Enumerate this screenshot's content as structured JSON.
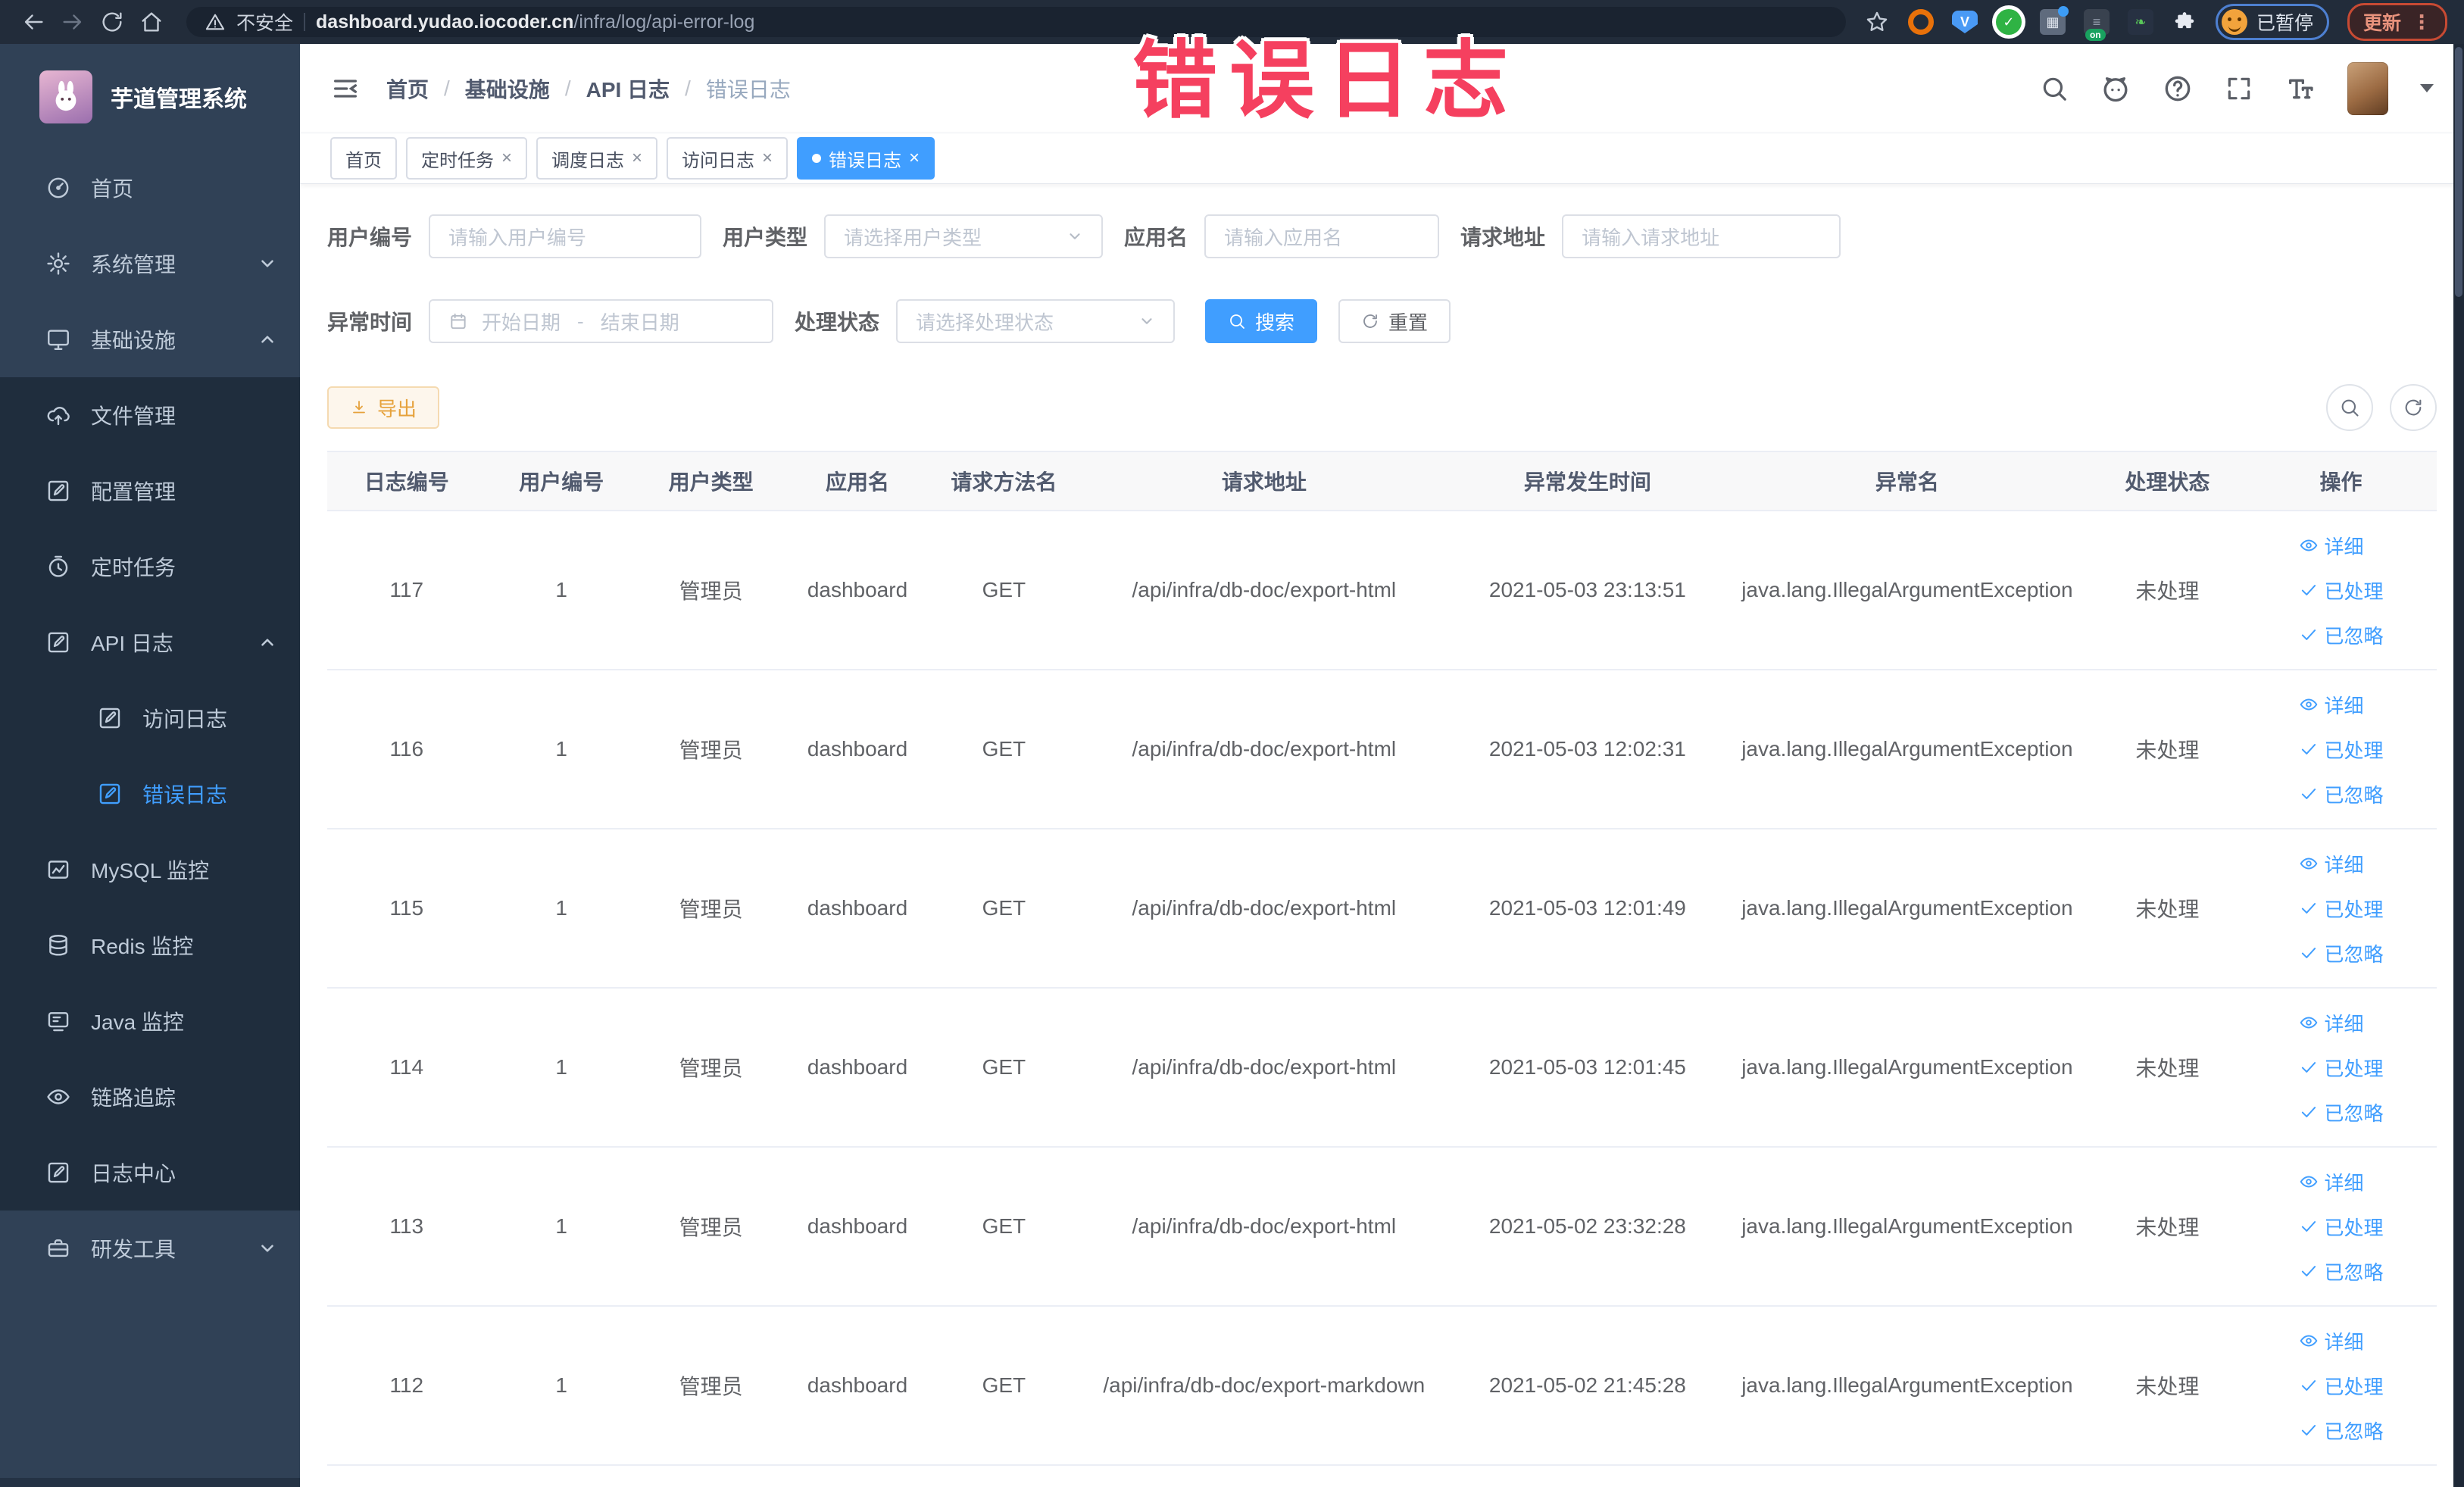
{
  "browser": {
    "security_label": "不安全",
    "url_domain": "dashboard.yudao.iocoder.cn",
    "url_path": "/infra/log/api-error-log",
    "profile_status": "已暂停",
    "update_button": "更新"
  },
  "annotation": {
    "text": "错误日志"
  },
  "sidebar": {
    "title": "芋道管理系统",
    "items": [
      {
        "label": "首页"
      },
      {
        "label": "系统管理"
      },
      {
        "label": "基础设施"
      },
      {
        "label": "文件管理"
      },
      {
        "label": "配置管理"
      },
      {
        "label": "定时任务"
      },
      {
        "label": "API 日志"
      },
      {
        "label": "访问日志"
      },
      {
        "label": "错误日志"
      },
      {
        "label": "MySQL 监控"
      },
      {
        "label": "Redis 监控"
      },
      {
        "label": "Java 监控"
      },
      {
        "label": "链路追踪"
      },
      {
        "label": "日志中心"
      },
      {
        "label": "研发工具"
      }
    ]
  },
  "breadcrumb": [
    "首页",
    "基础设施",
    "API 日志",
    "错误日志"
  ],
  "tags": [
    {
      "label": "首页"
    },
    {
      "label": "定时任务"
    },
    {
      "label": "调度日志"
    },
    {
      "label": "访问日志"
    },
    {
      "label": "错误日志"
    }
  ],
  "filters": {
    "user_id": {
      "label": "用户编号",
      "placeholder": "请输入用户编号"
    },
    "user_type": {
      "label": "用户类型",
      "placeholder": "请选择用户类型"
    },
    "app_name": {
      "label": "应用名",
      "placeholder": "请输入应用名"
    },
    "request_url": {
      "label": "请求地址",
      "placeholder": "请输入请求地址"
    },
    "exception_time": {
      "label": "异常时间",
      "start_placeholder": "开始日期",
      "separator": "-",
      "end_placeholder": "结束日期"
    },
    "process_status": {
      "label": "处理状态",
      "placeholder": "请选择处理状态"
    },
    "search_button": "搜索",
    "reset_button": "重置"
  },
  "toolbar": {
    "export_button": "导出"
  },
  "table": {
    "columns": [
      "日志编号",
      "用户编号",
      "用户类型",
      "应用名",
      "请求方法名",
      "请求地址",
      "异常发生时间",
      "异常名",
      "处理状态",
      "操作"
    ],
    "actions": {
      "detail": "详细",
      "processed": "已处理",
      "ignored": "已忽略"
    },
    "rows": [
      {
        "id": "117",
        "user_id": "1",
        "user_type": "管理员",
        "app": "dashboard",
        "method": "GET",
        "url": "/api/infra/db-doc/export-html",
        "time": "2021-05-03 23:13:51",
        "exception": "java.lang.IllegalArgumentException",
        "status": "未处理"
      },
      {
        "id": "116",
        "user_id": "1",
        "user_type": "管理员",
        "app": "dashboard",
        "method": "GET",
        "url": "/api/infra/db-doc/export-html",
        "time": "2021-05-03 12:02:31",
        "exception": "java.lang.IllegalArgumentException",
        "status": "未处理"
      },
      {
        "id": "115",
        "user_id": "1",
        "user_type": "管理员",
        "app": "dashboard",
        "method": "GET",
        "url": "/api/infra/db-doc/export-html",
        "time": "2021-05-03 12:01:49",
        "exception": "java.lang.IllegalArgumentException",
        "status": "未处理"
      },
      {
        "id": "114",
        "user_id": "1",
        "user_type": "管理员",
        "app": "dashboard",
        "method": "GET",
        "url": "/api/infra/db-doc/export-html",
        "time": "2021-05-03 12:01:45",
        "exception": "java.lang.IllegalArgumentException",
        "status": "未处理"
      },
      {
        "id": "113",
        "user_id": "1",
        "user_type": "管理员",
        "app": "dashboard",
        "method": "GET",
        "url": "/api/infra/db-doc/export-html",
        "time": "2021-05-02 23:32:28",
        "exception": "java.lang.IllegalArgumentException",
        "status": "未处理"
      },
      {
        "id": "112",
        "user_id": "1",
        "user_type": "管理员",
        "app": "dashboard",
        "method": "GET",
        "url": "/api/infra/db-doc/export-markdown",
        "time": "2021-05-02 21:45:28",
        "exception": "java.lang.IllegalArgumentException",
        "status": "未处理"
      }
    ]
  },
  "colors": {
    "accent": "#409eff",
    "sidebar_bg": "#304156",
    "submenu_bg": "#1f2d3d",
    "warning": "#e6a23c",
    "annotation": "#f5405f"
  }
}
